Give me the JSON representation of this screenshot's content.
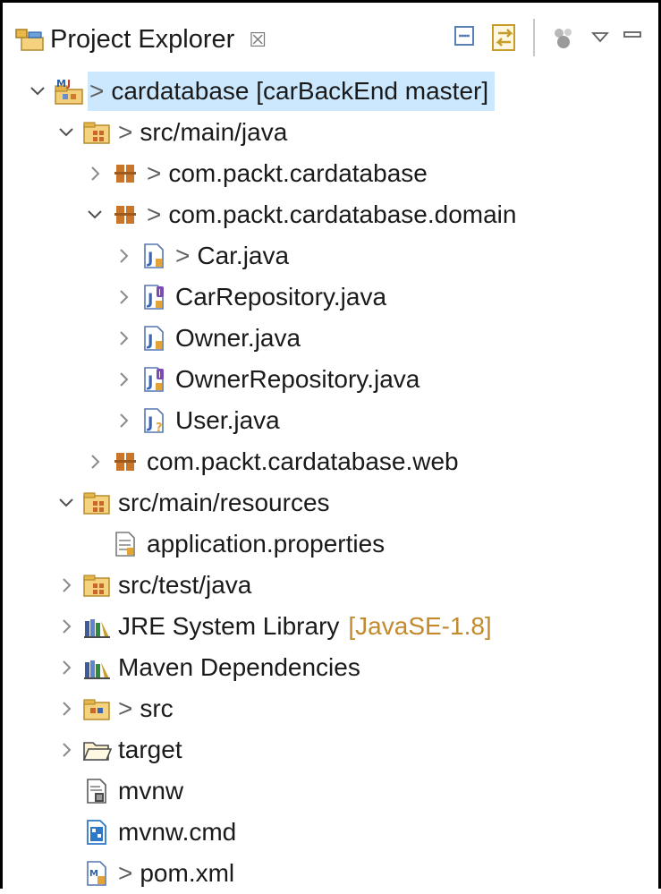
{
  "view": {
    "title": "Project Explorer",
    "close_glyph": "☒"
  },
  "toolbar": {
    "buttons": [
      {
        "name": "collapse-all-icon"
      },
      {
        "name": "link-with-editor-icon"
      },
      {
        "name": "build-icon"
      },
      {
        "name": "view-menu-icon"
      },
      {
        "name": "minimize-icon"
      }
    ]
  },
  "tree": [
    {
      "label": "cardatabase [carBackEnd master]",
      "dirty": ">",
      "icon": "maven-project-icon",
      "twisty": "expanded",
      "depth": 0,
      "selected": true
    },
    {
      "label": "src/main/java",
      "dirty": ">",
      "icon": "source-folder-icon",
      "twisty": "expanded",
      "depth": 1
    },
    {
      "label": "com.packt.cardatabase",
      "dirty": ">",
      "icon": "package-icon",
      "twisty": "collapsed",
      "depth": 2
    },
    {
      "label": "com.packt.cardatabase.domain",
      "dirty": ">",
      "icon": "package-icon",
      "twisty": "expanded",
      "depth": 2
    },
    {
      "label": "Car.java",
      "dirty": ">",
      "icon": "java-class-icon",
      "twisty": "collapsed",
      "depth": 3
    },
    {
      "label": "CarRepository.java",
      "dirty": "",
      "icon": "java-interface-icon",
      "twisty": "collapsed",
      "depth": 3
    },
    {
      "label": "Owner.java",
      "dirty": "",
      "icon": "java-class-icon",
      "twisty": "collapsed",
      "depth": 3
    },
    {
      "label": "OwnerRepository.java",
      "dirty": "",
      "icon": "java-interface-icon",
      "twisty": "collapsed",
      "depth": 3
    },
    {
      "label": "User.java",
      "dirty": "",
      "icon": "java-class-unknown-icon",
      "twisty": "collapsed",
      "depth": 3
    },
    {
      "label": "com.packt.cardatabase.web",
      "dirty": "",
      "icon": "package-icon",
      "twisty": "collapsed",
      "depth": 2
    },
    {
      "label": "src/main/resources",
      "dirty": "",
      "icon": "source-folder-icon",
      "twisty": "expanded",
      "depth": 1
    },
    {
      "label": "application.properties",
      "dirty": "",
      "icon": "properties-file-icon",
      "twisty": "none",
      "depth": 2
    },
    {
      "label": "src/test/java",
      "dirty": "",
      "icon": "source-folder-icon",
      "twisty": "collapsed",
      "depth": 1
    },
    {
      "label": "JRE System Library",
      "dirty": "",
      "decoration": "[JavaSE-1.8]",
      "icon": "library-icon",
      "twisty": "collapsed",
      "depth": 1
    },
    {
      "label": "Maven Dependencies",
      "dirty": "",
      "icon": "library-icon",
      "twisty": "collapsed",
      "depth": 1
    },
    {
      "label": "src",
      "dirty": ">",
      "icon": "folder-dirty-icon",
      "twisty": "collapsed",
      "depth": 1
    },
    {
      "label": "target",
      "dirty": "",
      "icon": "folder-open-icon",
      "twisty": "collapsed",
      "depth": 1
    },
    {
      "label": "mvnw",
      "dirty": "",
      "icon": "file-icon",
      "twisty": "none",
      "depth": 1
    },
    {
      "label": "mvnw.cmd",
      "dirty": "",
      "icon": "cmd-file-icon",
      "twisty": "none",
      "depth": 1
    },
    {
      "label": "pom.xml",
      "dirty": ">",
      "icon": "xml-file-icon",
      "twisty": "none",
      "depth": 1
    }
  ]
}
